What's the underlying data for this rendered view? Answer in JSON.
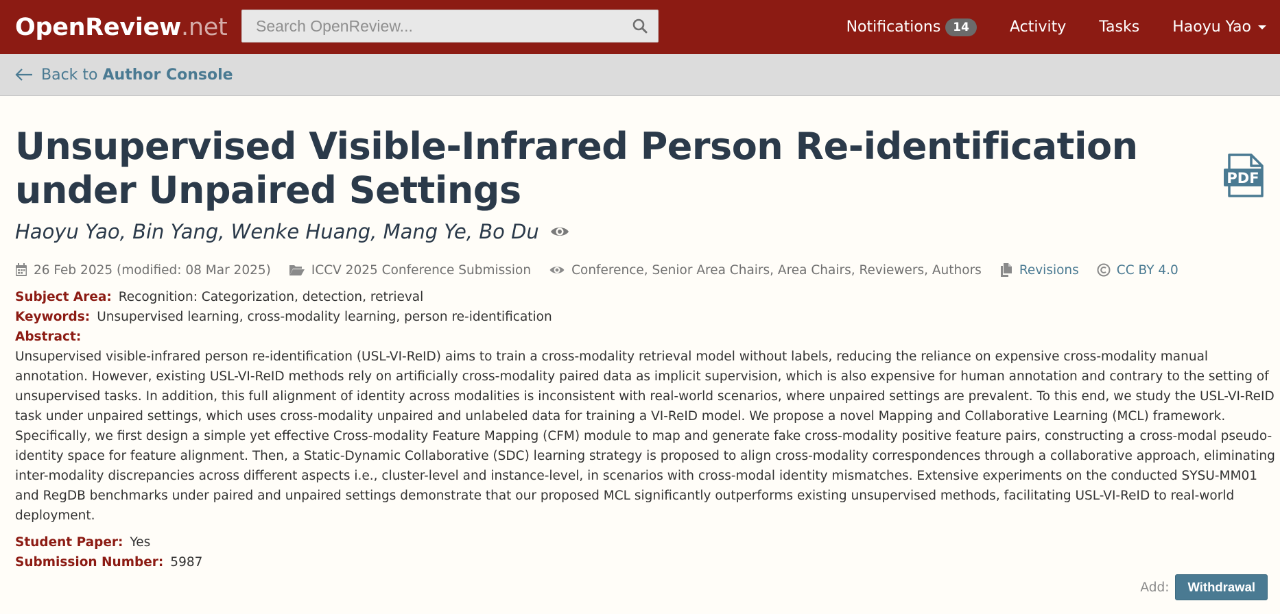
{
  "navbar": {
    "brand_main": "OpenReview",
    "brand_tld": ".net",
    "search_placeholder": "Search OpenReview...",
    "notifications_label": "Notifications",
    "notifications_count": "14",
    "activity_label": "Activity",
    "tasks_label": "Tasks",
    "user_name": "Haoyu Yao"
  },
  "backbar": {
    "prefix": "Back to",
    "target": "Author Console"
  },
  "paper": {
    "title": "Unsupervised Visible-Infrared Person Re-identification under Unpaired Settings",
    "authors": "Haoyu Yao, Bin Yang, Wenke Huang, Mang Ye, Bo Du",
    "date": "26 Feb 2025 (modified: 08 Mar 2025)",
    "venue": "ICCV 2025 Conference Submission",
    "readers": "Conference, Senior Area Chairs, Area Chairs, Reviewers, Authors",
    "revisions_label": "Revisions",
    "license_label": "CC BY 4.0",
    "pdf_label": "PDF"
  },
  "fields": {
    "subject_area_label": "Subject Area:",
    "subject_area_value": "Recognition: Categorization, detection, retrieval",
    "keywords_label": "Keywords:",
    "keywords_value": "Unsupervised learning, cross-modality learning, person re-identification",
    "abstract_label": "Abstract:",
    "abstract_value": "Unsupervised visible-infrared person re-identification (USL-VI-ReID) aims to train a cross-modality retrieval model without labels, reducing the reliance on expensive cross-modality manual annotation. However, existing USL-VI-ReID methods rely on artificially cross-modality paired data as implicit supervision, which is also expensive for human annotation and contrary to the setting of unsupervised tasks. In addition, this full alignment of identity across modalities is inconsistent with real-world scenarios, where unpaired settings are prevalent. To this end, we study the USL-VI-ReID task under unpaired settings, which uses cross-modality unpaired and unlabeled data for training a VI-ReID model. We propose a novel Mapping and Collaborative Learning (MCL) framework. Specifically, we first design a simple yet effective Cross-modality Feature Mapping (CFM) module to map and generate fake cross-modality positive feature pairs, constructing a cross-modal pseudo-identity space for feature alignment. Then, a Static-Dynamic Collaborative (SDC) learning strategy is proposed to align cross-modality correspondences through a collaborative approach, eliminating inter-modality discrepancies across different aspects i.e., cluster-level and instance-level, in scenarios with cross-modal identity mismatches. Extensive experiments on the conducted SYSU-MM01 and RegDB benchmarks under paired and unpaired settings demonstrate that our proposed MCL significantly outperforms existing unsupervised methods, facilitating USL-VI-ReID to real-world deployment.",
    "student_paper_label": "Student Paper:",
    "student_paper_value": "Yes",
    "submission_number_label": "Submission Number:",
    "submission_number_value": "5987"
  },
  "actions": {
    "add_label": "Add:",
    "withdrawal_label": "Withdrawal"
  },
  "colors": {
    "navbar_bg": "#8c1b13",
    "field_label": "#8c1b13",
    "link": "#4a7a92",
    "title": "#2b3a4a",
    "page_bg": "#fffdf8"
  },
  "icons": {
    "search": "search-icon",
    "back": "arrow-left-icon",
    "pdf": "pdf-file-icon",
    "eye": "eye-icon",
    "calendar": "calendar-icon",
    "folder": "folder-open-icon",
    "revisions": "files-icon",
    "license": "copyright-icon",
    "user_menu": "caret-down-icon"
  }
}
